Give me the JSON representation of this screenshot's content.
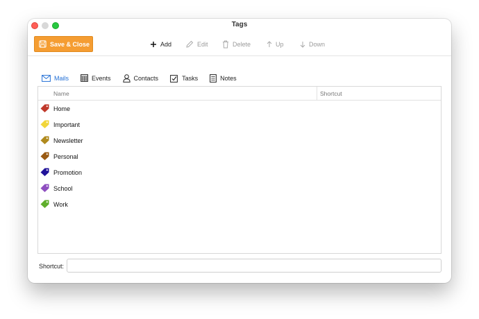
{
  "window": {
    "title": "Tags"
  },
  "toolbar": {
    "save_label": "Save & Close",
    "add_label": "Add",
    "edit_label": "Edit",
    "delete_label": "Delete",
    "up_label": "Up",
    "down_label": "Down",
    "accent_color": "#f59d32"
  },
  "tabs": [
    {
      "label": "Mails",
      "icon": "mail-icon",
      "active": true
    },
    {
      "label": "Events",
      "icon": "calendar-icon",
      "active": false
    },
    {
      "label": "Contacts",
      "icon": "person-icon",
      "active": false
    },
    {
      "label": "Tasks",
      "icon": "checkbox-icon",
      "active": false
    },
    {
      "label": "Notes",
      "icon": "note-icon",
      "active": false
    }
  ],
  "table": {
    "columns": [
      "Name",
      "Shortcut"
    ],
    "rows": [
      {
        "name": "Home",
        "shortcut": "",
        "color": "#c0392b"
      },
      {
        "name": "Important",
        "shortcut": "",
        "color": "#f1d63a"
      },
      {
        "name": "Newsletter",
        "shortcut": "",
        "color": "#b08a1e"
      },
      {
        "name": "Personal",
        "shortcut": "",
        "color": "#9a5a12"
      },
      {
        "name": "Promotion",
        "shortcut": "",
        "color": "#21139a"
      },
      {
        "name": "School",
        "shortcut": "",
        "color": "#8e4fc0"
      },
      {
        "name": "Work",
        "shortcut": "",
        "color": "#5fae2c"
      }
    ]
  },
  "shortcut": {
    "label": "Shortcut:",
    "value": ""
  }
}
